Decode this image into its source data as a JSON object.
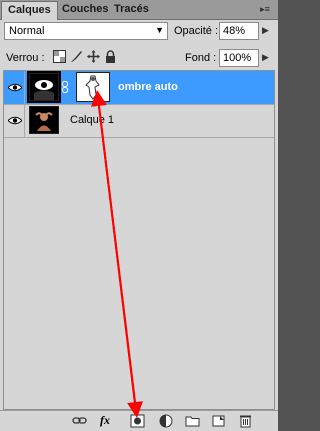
{
  "tabs": [
    {
      "label": "Calques",
      "active": true
    },
    {
      "label": "Couches",
      "active": false
    },
    {
      "label": "Tracés",
      "active": false
    }
  ],
  "blend_mode": {
    "value": "Normal"
  },
  "opacity": {
    "label": "Opacité :",
    "value": "48%"
  },
  "lock": {
    "label": "Verrou :",
    "icons": [
      "lock-transparent-pixels-icon",
      "lock-image-pixels-icon",
      "lock-position-icon",
      "lock-all-icon"
    ]
  },
  "fill": {
    "label": "Fond :",
    "value": "100%"
  },
  "layers": [
    {
      "name": "ombre auto",
      "selected": true,
      "has_mask": true
    },
    {
      "name": "Calque 1",
      "selected": false,
      "has_mask": false
    }
  ],
  "bottom_icons": [
    "link-layers-icon",
    "fx-icon",
    "add-mask-icon",
    "adjustment-layer-icon",
    "group-folder-icon",
    "new-layer-icon",
    "trash-icon"
  ],
  "fx_label": "fx",
  "colors": {
    "selection": "#3d9bff",
    "annotation_arrow": "#ff0000",
    "panel_bg": "#d6d6d6"
  }
}
